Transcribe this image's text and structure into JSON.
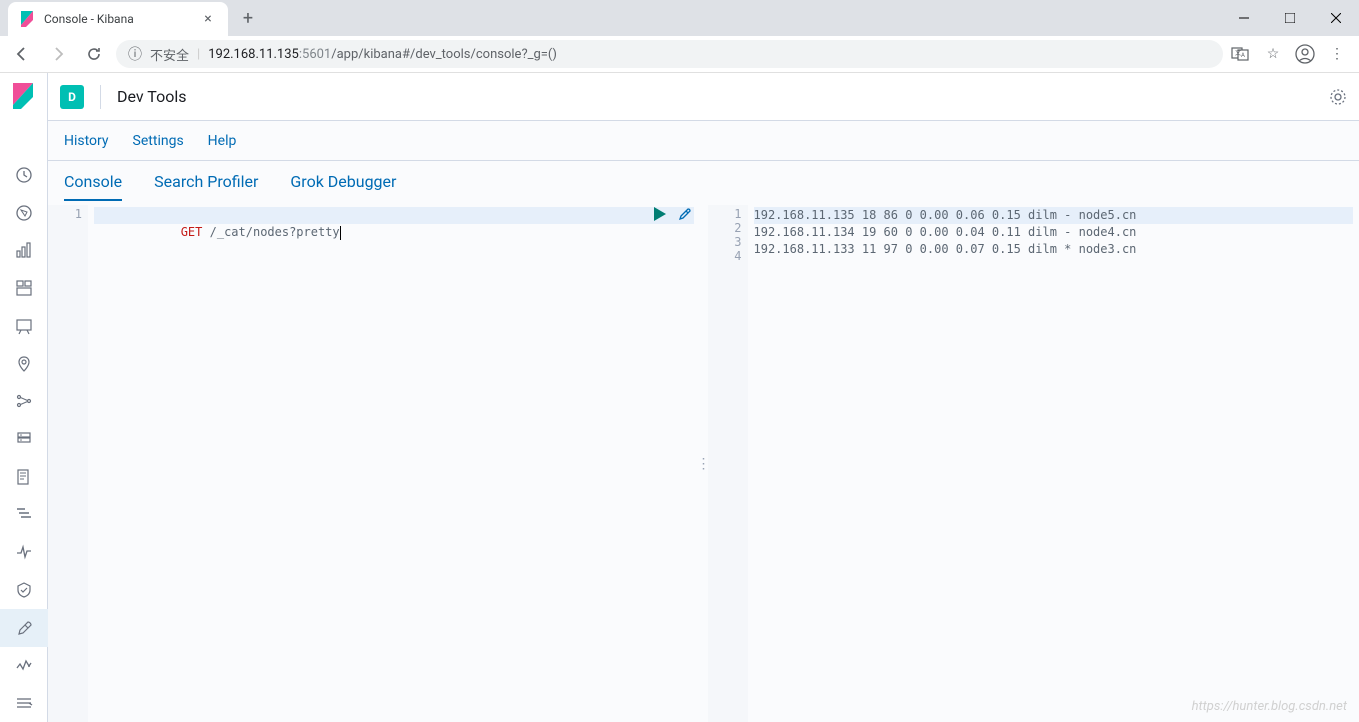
{
  "browser": {
    "tab_title": "Console - Kibana",
    "insecure_label": "不安全",
    "url_host": "192.168.11.135",
    "url_port": ":5601",
    "url_path": "/app/kibana#/dev_tools/console?_g=()"
  },
  "header": {
    "badge": "D",
    "title": "Dev Tools"
  },
  "subnav": {
    "history": "History",
    "settings": "Settings",
    "help": "Help"
  },
  "tabs": {
    "console": "Console",
    "profiler": "Search Profiler",
    "grok": "Grok Debugger"
  },
  "editor": {
    "lines": [
      {
        "n": "1",
        "method": "GET",
        "path": " /_cat/nodes?pretty"
      }
    ]
  },
  "output": {
    "lines": [
      {
        "n": "1",
        "text": "192.168.11.135 18 86 0 0.00 0.06 0.15 dilm - node5.cn"
      },
      {
        "n": "2",
        "text": "192.168.11.134 19 60 0 0.00 0.04 0.11 dilm - node4.cn"
      },
      {
        "n": "3",
        "text": "192.168.11.133 11 97 0 0.00 0.07 0.15 dilm * node3.cn"
      },
      {
        "n": "4",
        "text": ""
      }
    ]
  },
  "watermark": "https://hunter.blog.csdn.net"
}
